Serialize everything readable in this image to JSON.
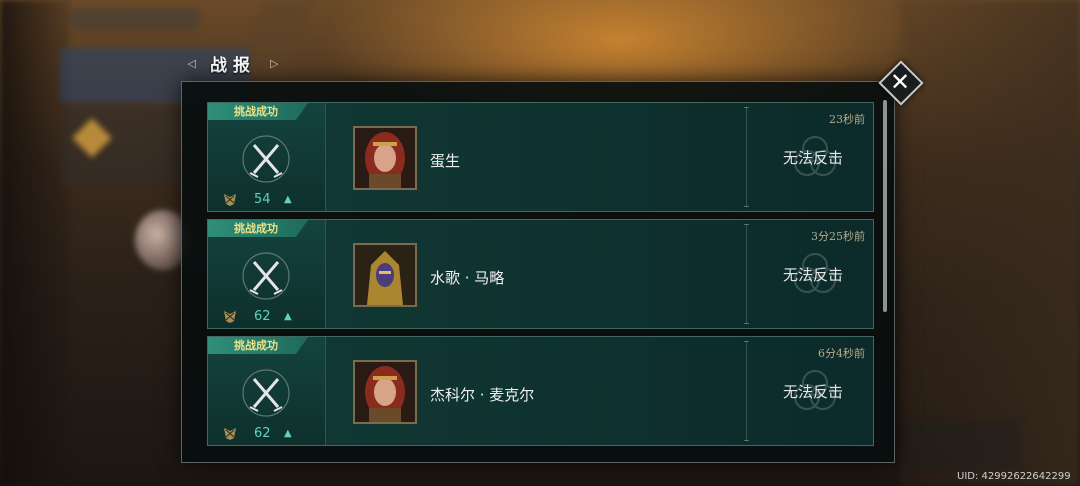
{
  "header": {
    "title": "战报",
    "prev_arrow": "◁",
    "next_arrow": "▷"
  },
  "close": {
    "glyph": "✕"
  },
  "reports": [
    {
      "status": "挑战成功",
      "rank": "54",
      "name": "蛋生",
      "time": "23秒前",
      "action": "无法反击",
      "avatar": "red-hair-woman-avatar"
    },
    {
      "status": "挑战成功",
      "rank": "62",
      "name": "水歌 · 马略",
      "time": "3分25秒前",
      "action": "无法反击",
      "avatar": "gold-armored-warrior-avatar"
    },
    {
      "status": "挑战成功",
      "rank": "62",
      "name": "杰科尔 · 麦克尔",
      "time": "6分4秒前",
      "action": "无法反击",
      "avatar": "red-hair-woman-avatar"
    }
  ],
  "uid": "UID: 429926226422​99",
  "colors": {
    "accent": "#5fd3c0",
    "tag_text": "#e9e38a",
    "card_bg": "#0f3330"
  }
}
